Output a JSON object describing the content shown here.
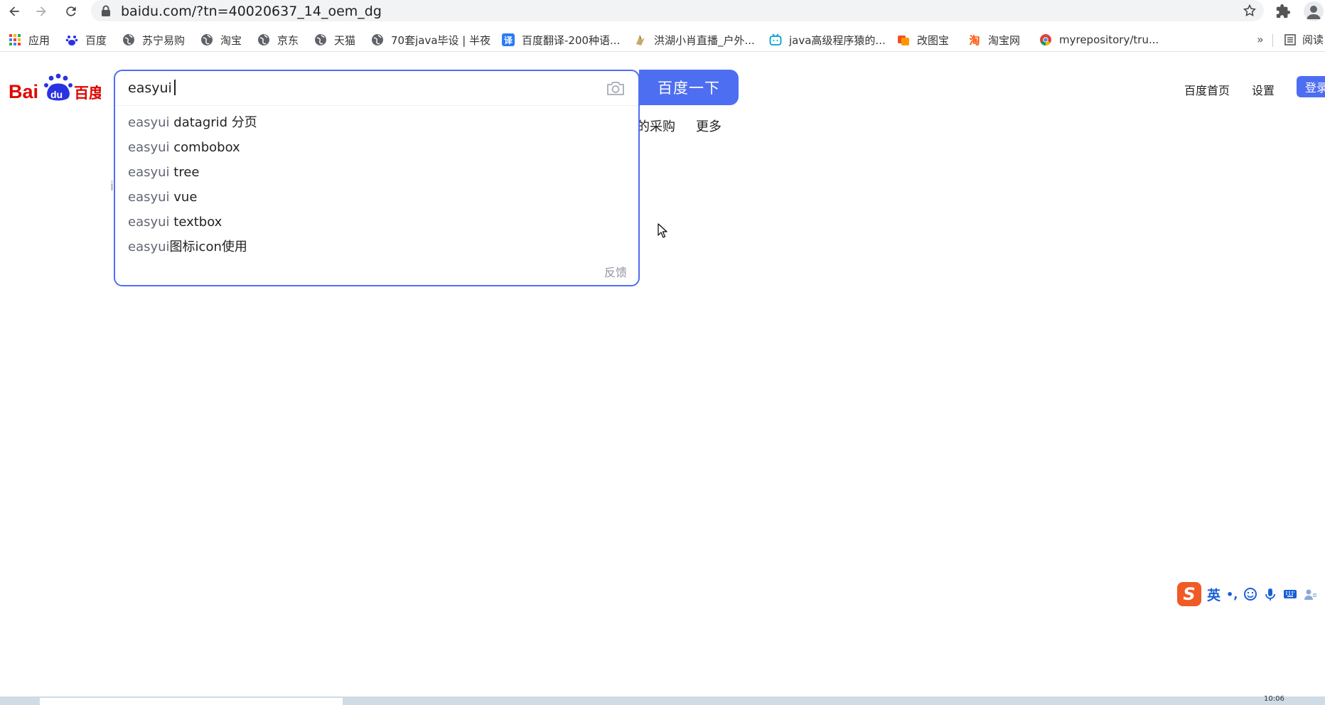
{
  "browser": {
    "url": "baidu.com/?tn=40020637_14_oem_dg"
  },
  "bookmarks": [
    {
      "label": "应用",
      "icon": "apps-grid-icon"
    },
    {
      "label": "百度",
      "icon": "baidu-paw-icon"
    },
    {
      "label": "苏宁易购",
      "icon": "globe-icon"
    },
    {
      "label": "淘宝",
      "icon": "globe-icon"
    },
    {
      "label": "京东",
      "icon": "globe-icon"
    },
    {
      "label": "天猫",
      "icon": "globe-icon"
    },
    {
      "label": "70套java毕设 | 半夜",
      "icon": "globe-icon"
    },
    {
      "label": "百度翻译-200种语...",
      "icon": "baidu-translate-icon"
    },
    {
      "label": "洪湖小肖直播_户外...",
      "icon": "live-stream-icon"
    },
    {
      "label": "java高级程序猿的...",
      "icon": "bilibili-icon"
    },
    {
      "label": "改图宝",
      "icon": "gaitubao-icon"
    },
    {
      "label": "淘宝网",
      "icon": "taobao-icon"
    },
    {
      "label": "myrepository/tru...",
      "icon": "chrome-icon"
    }
  ],
  "bookmarks_more": "»",
  "bookmarks_reading": "阅读",
  "search": {
    "query": "easyui",
    "button_label": "百度一下",
    "suggestions": [
      {
        "prefix": "easyui",
        "rest": " datagrid 分页"
      },
      {
        "prefix": "easyui",
        "rest": " combobox"
      },
      {
        "prefix": "easyui",
        "rest": " tree"
      },
      {
        "prefix": "easyui",
        "rest": " vue"
      },
      {
        "prefix": "easyui",
        "rest": " textbox"
      },
      {
        "prefix": "easyui",
        "rest": "图标icon使用"
      }
    ],
    "feedback": "反馈"
  },
  "nav": {
    "behind_dropdown_text": "i",
    "partial_item": "的采购",
    "more": "更多",
    "home": "百度首页",
    "settings": "设置",
    "login": "登录"
  },
  "ime": {
    "lang": "英",
    "punct": "•,"
  },
  "taskbar": {
    "clock": "10:06"
  },
  "colors": {
    "accent": "#4e6ef2",
    "logo_red": "#e10601",
    "logo_blue": "#2932e1"
  }
}
